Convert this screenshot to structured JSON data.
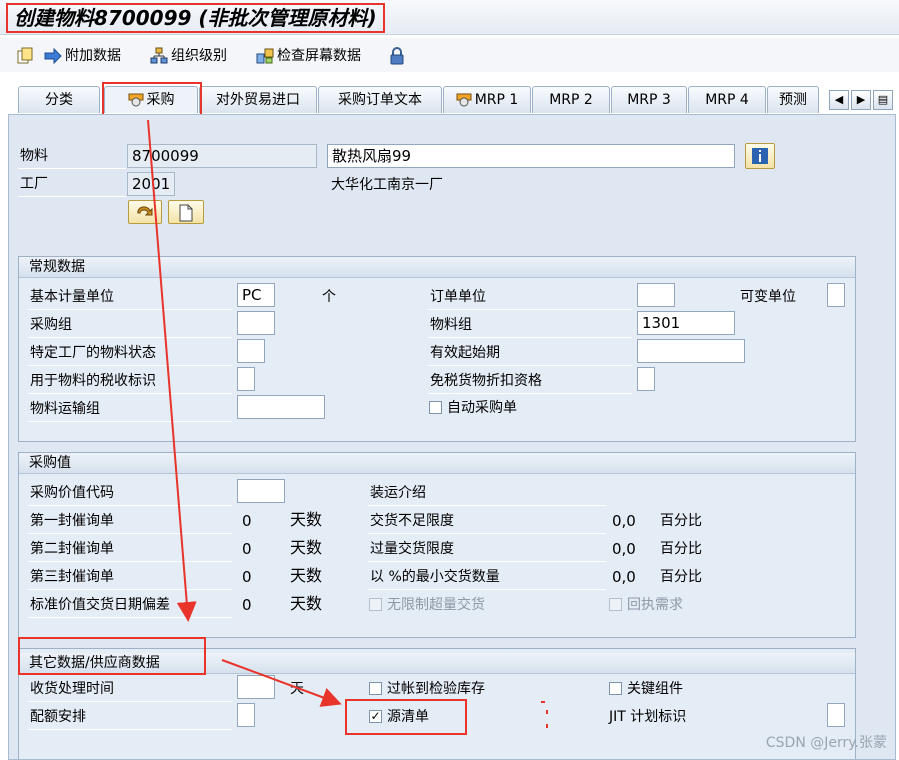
{
  "window": {
    "title": "创建物料8700099 (非批次管理原材料)"
  },
  "toolbar": {
    "items": [
      {
        "label": "附加数据",
        "icon": "arrow-right-icon"
      },
      {
        "label": "组织级别",
        "icon": "org-levels-icon"
      },
      {
        "label": "检查屏幕数据",
        "icon": "check-screen-data-icon"
      }
    ],
    "lock_icon": "lock-icon"
  },
  "tabs": [
    {
      "label": "分类"
    },
    {
      "label": "采购",
      "active": true
    },
    {
      "label": "对外贸易进口"
    },
    {
      "label": "采购订单文本"
    },
    {
      "label": "MRP 1"
    },
    {
      "label": "MRP 2"
    },
    {
      "label": "MRP 3"
    },
    {
      "label": "MRP 4"
    },
    {
      "label": "预测"
    }
  ],
  "header": {
    "material_label": "物料",
    "material_value": "8700099",
    "material_desc": "散热风扇99",
    "plant_label": "工厂",
    "plant_value": "2001",
    "plant_desc": "大华化工南京一厂"
  },
  "general": {
    "title": "常规数据",
    "base_uom_label": "基本计量单位",
    "base_uom_value": "PC",
    "base_uom_text": "个",
    "order_unit_label": "订单单位",
    "order_unit_value": "",
    "var_unit_label": "可变单位",
    "purch_group_label": "采购组",
    "purch_group_value": "",
    "material_group_label": "物料组",
    "material_group_value": "1301",
    "plant_status_label": "特定工厂的物料状态",
    "valid_from_label": "有效起始期",
    "tax_ind_label": "用于物料的税收标识",
    "qual_discount_label": "免税货物折扣资格",
    "mat_freight_label": "物料运输组",
    "auto_po_label": "自动采购单"
  },
  "purch_values": {
    "title": "采购值",
    "key_label": "采购价值代码",
    "shipping_label": "装运介绍",
    "rem1_label": "第一封催询单",
    "rem1_value": "0",
    "rem2_label": "第二封催询单",
    "rem2_value": "0",
    "rem3_label": "第三封催询单",
    "rem3_value": "0",
    "stdev_label": "标准价值交货日期偏差",
    "stdev_value": "0",
    "days_unit": "天数",
    "under_tol_label": "交货不足限度",
    "under_tol_value": "0,0",
    "over_tol_label": "过量交货限度",
    "over_tol_value": "0,0",
    "min_del_label": "以 %的最小交货数量",
    "min_del_value": "0,0",
    "percent_unit": "百分比",
    "unlimited_label": "无限制超量交货",
    "ack_label": "回执需求"
  },
  "other": {
    "title": "其它数据/供应商数据",
    "gr_time_label": "收货处理时间",
    "gr_time_unit": "天",
    "post_insp_label": "过帐到检验库存",
    "critical_label": "关键组件",
    "quota_label": "配额安排",
    "source_list_label": "源清单",
    "source_list_checked": true,
    "jit_label": "JIT 计划标识"
  },
  "watermark": "CSDN @Jerry.张蒙",
  "colors": {
    "highlight": "#e8342a",
    "panel": "#dfe8f2"
  }
}
